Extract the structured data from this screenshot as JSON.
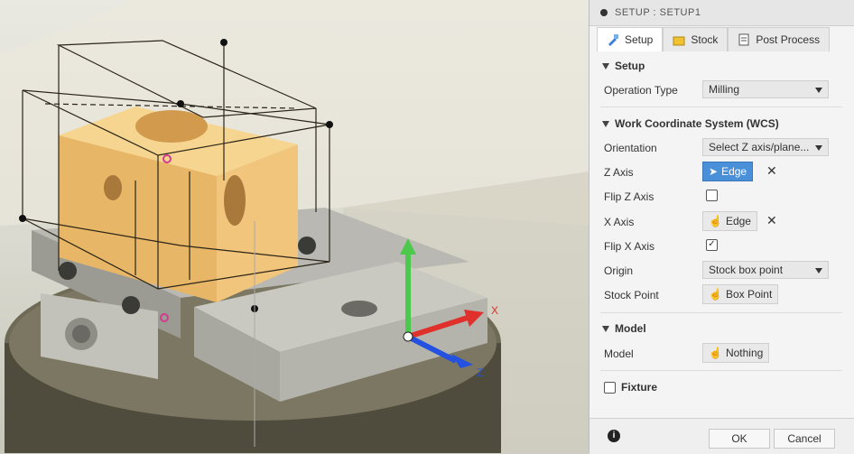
{
  "viewport": {
    "axis_x_label": "X",
    "axis_z_label": "Z",
    "colors": {
      "x_axis": "#e0302c",
      "y_axis": "#4cc94c",
      "z_axis": "#2451e0",
      "stock": "#f3c36a",
      "box_handle": "#222",
      "origin_marker": "#d13c8f"
    }
  },
  "panel": {
    "title": "SETUP : SETUP1",
    "title_icon": "setup-bullet-icon",
    "tabs": [
      {
        "label": "Setup",
        "icon": "setup-icon",
        "active": true
      },
      {
        "label": "Stock",
        "icon": "stock-icon",
        "active": false
      },
      {
        "label": "Post Process",
        "icon": "post-process-icon",
        "active": false
      }
    ],
    "setup_section": "Setup",
    "operation_type": {
      "label": "Operation Type",
      "value": "Milling"
    },
    "wcs_section": "Work Coordinate System (WCS)",
    "orientation": {
      "label": "Orientation",
      "value": "Select Z axis/plane..."
    },
    "z_axis": {
      "label": "Z Axis",
      "value": "Edge"
    },
    "flip_z": {
      "label": "Flip Z Axis",
      "checked": false
    },
    "x_axis": {
      "label": "X Axis",
      "value": "Edge"
    },
    "flip_x": {
      "label": "Flip X Axis",
      "checked": true
    },
    "origin": {
      "label": "Origin",
      "value": "Stock box point"
    },
    "stock_point": {
      "label": "Stock Point",
      "value": "Box Point"
    },
    "model_section": "Model",
    "model": {
      "label": "Model",
      "value": "Nothing"
    },
    "fixture_label": "Fixture",
    "footer": {
      "info_icon": "info-icon",
      "ok": "OK",
      "cancel": "Cancel"
    }
  }
}
